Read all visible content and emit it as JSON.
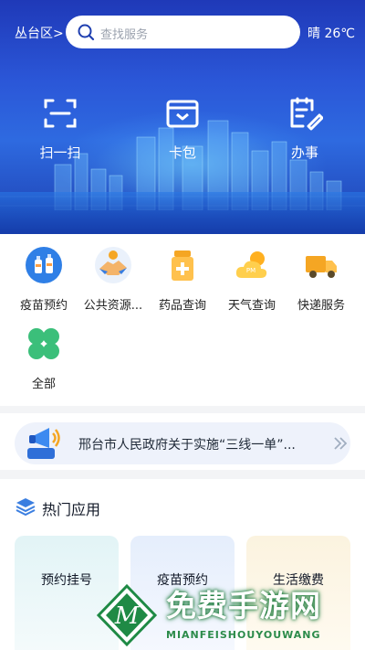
{
  "header": {
    "district": "丛台区>",
    "search_placeholder": "查找服务",
    "weather": "晴 26℃"
  },
  "quick_actions": [
    {
      "label": "扫一扫",
      "icon": "scan-icon"
    },
    {
      "label": "卡包",
      "icon": "card-wallet-icon"
    },
    {
      "label": "办事",
      "icon": "document-edit-icon"
    }
  ],
  "services": [
    {
      "label": "疫苗预约",
      "icon": "vaccine-icon"
    },
    {
      "label": "公共资源...",
      "icon": "handshake-icon"
    },
    {
      "label": "药品查询",
      "icon": "medicine-bottle-icon"
    },
    {
      "label": "天气查询",
      "icon": "pm25-cloud-icon"
    },
    {
      "label": "快递服务",
      "icon": "delivery-truck-icon"
    },
    {
      "label": "全部",
      "icon": "all-clover-icon"
    }
  ],
  "notice": {
    "text": "邢台市人民政府关于实施“三线一单”...",
    "icon": "megaphone-icon"
  },
  "hot_apps": {
    "title": "热门应用",
    "items": [
      {
        "label": "预约挂号"
      },
      {
        "label": "疫苗预约"
      },
      {
        "label": "生活缴费"
      }
    ]
  },
  "watermark": {
    "title": "免费手游网",
    "subtitle": "MIANFEISHOUYOUWANG"
  },
  "colors": {
    "banner_blue": "#1f39b8",
    "accent_orange": "#f5a623",
    "accent_green": "#3bbf7a"
  }
}
